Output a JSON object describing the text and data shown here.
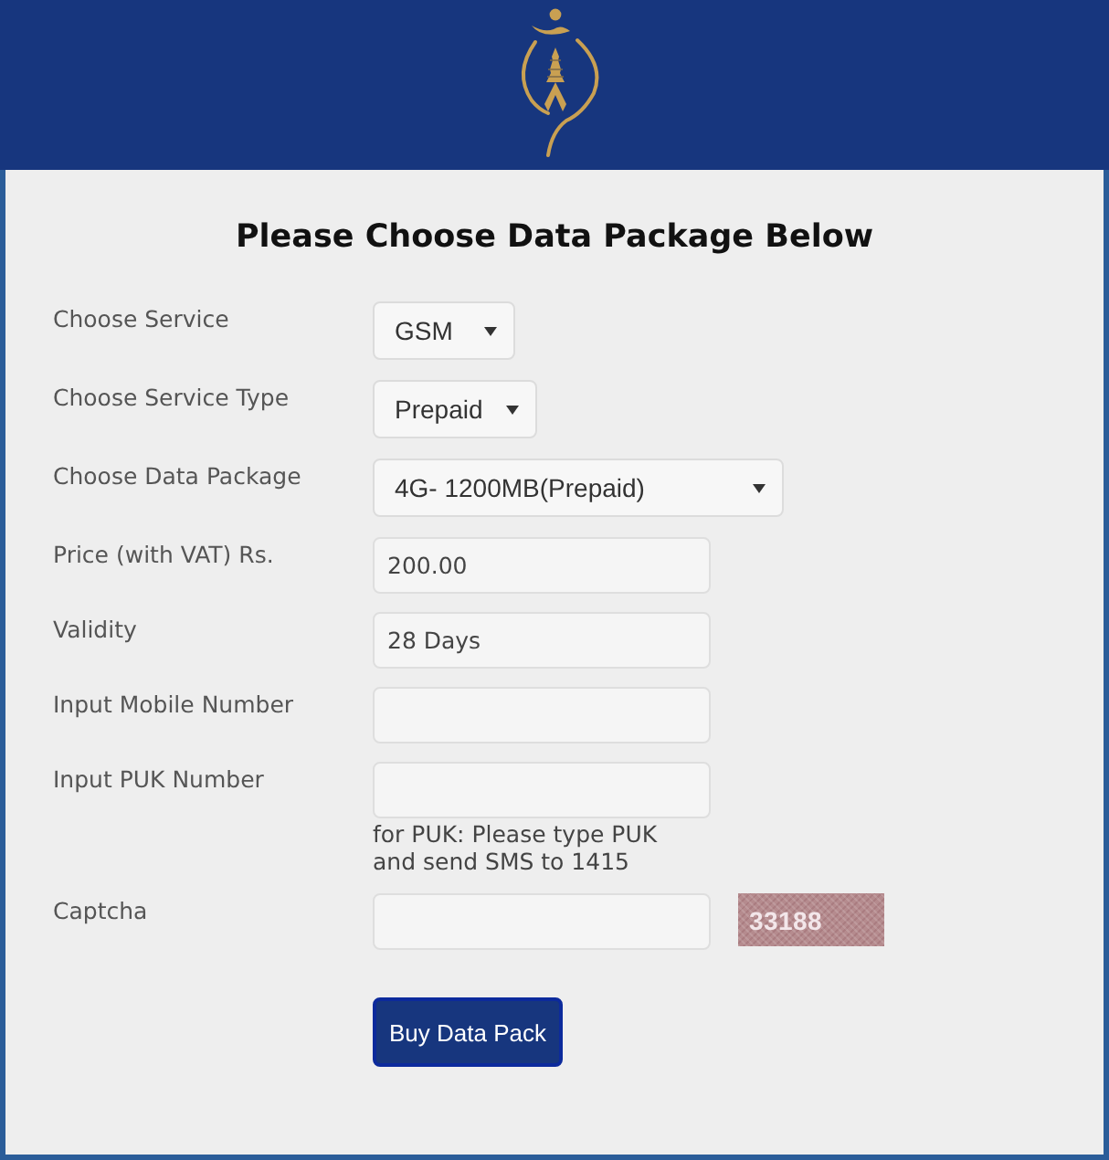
{
  "title": "Please Choose Data Package Below",
  "fields": [
    {
      "kind": "select",
      "label": "Choose Service",
      "value": "GSM"
    },
    {
      "kind": "select",
      "label": "Choose Service Type",
      "value": "Prepaid"
    },
    {
      "kind": "select",
      "label": "Choose Data Package",
      "value": "4G- 1200MB(Prepaid)"
    },
    {
      "kind": "input",
      "label": "Price (with VAT) Rs.",
      "value": "200.00"
    },
    {
      "kind": "input",
      "label": "Validity",
      "value": "28 Days"
    },
    {
      "kind": "input",
      "label": "Input Mobile Number"
    },
    {
      "kind": "input",
      "label": "Input PUK Number",
      "hint": "for PUK: Please type PUK and send SMS to 1415"
    },
    {
      "kind": "captcha",
      "label": "Captcha",
      "code": "33188"
    }
  ],
  "submit_button": "Buy Data Pack"
}
